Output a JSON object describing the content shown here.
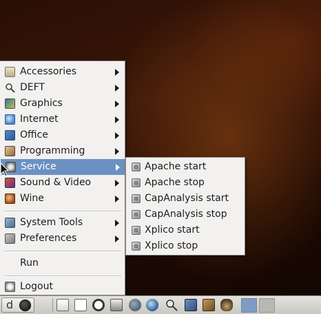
{
  "menu": {
    "items": [
      {
        "label": "Accessories",
        "icon": "accessories-icon",
        "has_submenu": true
      },
      {
        "label": "DEFT",
        "icon": "deft-icon",
        "has_submenu": true
      },
      {
        "label": "Graphics",
        "icon": "graphics-icon",
        "has_submenu": true
      },
      {
        "label": "Internet",
        "icon": "internet-icon",
        "has_submenu": true
      },
      {
        "label": "Office",
        "icon": "office-icon",
        "has_submenu": true
      },
      {
        "label": "Programming",
        "icon": "programming-icon",
        "has_submenu": true
      },
      {
        "label": "Service",
        "icon": "service-icon",
        "has_submenu": true,
        "selected": true
      },
      {
        "label": "Sound & Video",
        "icon": "sound-video-icon",
        "has_submenu": true
      },
      {
        "label": "Wine",
        "icon": "wine-icon",
        "has_submenu": true
      },
      {
        "label": "System Tools",
        "icon": "system-tools-icon",
        "has_submenu": true
      },
      {
        "label": "Preferences",
        "icon": "preferences-icon",
        "has_submenu": true
      },
      {
        "label": "Run"
      },
      {
        "label": "Logout",
        "icon": "logout-icon"
      }
    ],
    "selected_color": "#6b91c2"
  },
  "submenu": {
    "items": [
      {
        "label": "Apache start"
      },
      {
        "label": "Apache stop"
      },
      {
        "label": "CapAnalysis start"
      },
      {
        "label": "CapAnalysis stop"
      },
      {
        "label": "Xplico start"
      },
      {
        "label": "Xplico stop"
      }
    ]
  },
  "taskbar": {
    "start_label": "d"
  }
}
